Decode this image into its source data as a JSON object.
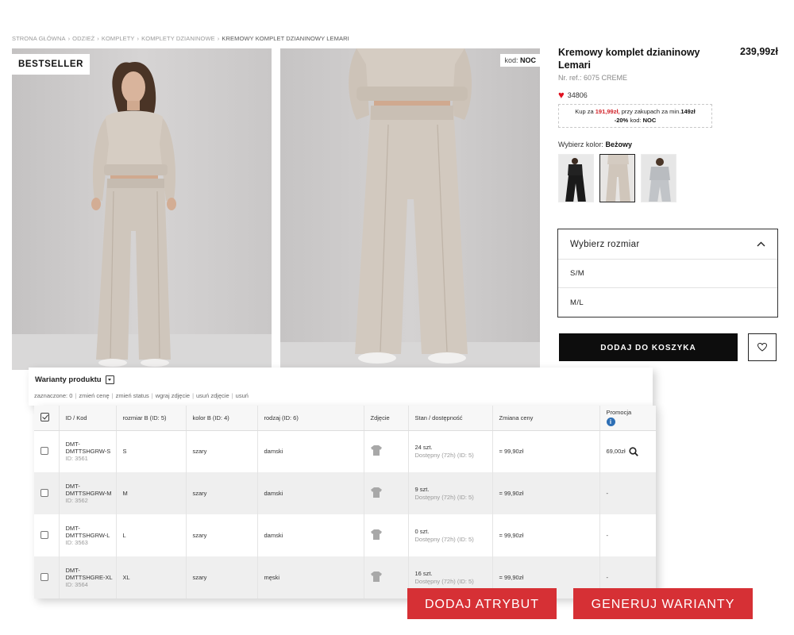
{
  "breadcrumb": [
    "STRONA GŁÓWNA",
    "ODZIEŻ",
    "KOMPLETY",
    "KOMPLETY DZIANINOWE",
    "KREMOWY KOMPLET DZIANINOWY LEMARI"
  ],
  "breadcrumb_separator": "›",
  "photos": {
    "badge": "BESTSELLER",
    "code_label": "kod:",
    "code_value": "NOC"
  },
  "product": {
    "title": "Kremowy komplet dzianinowy Lemari",
    "price": "239,99zł",
    "ref": "Nr. ref.: 6075 CREME",
    "likes": "34806",
    "promo": {
      "prefix": "Kup za",
      "price": "191,99zł,",
      "middle": "przy zakupach za min.",
      "min": "149zł",
      "discount": "-20%",
      "code_label": "kod:",
      "code": "NOC"
    },
    "color_label": "Wybierz kolor:",
    "color_value": "Beżowy",
    "swatches": [
      "black",
      "beige",
      "grey"
    ],
    "size": {
      "header": "Wybierz rozmiar",
      "options": [
        "S/M",
        "M/L"
      ]
    },
    "add_to_cart": "DODAJ DO KOSZYKA"
  },
  "admin": {
    "title": "Warianty produktu",
    "links": [
      "zaznaczone: 0",
      "zmień cenę",
      "zmień status",
      "wgraj zdjęcie",
      "usuń zdjęcie",
      "usuń"
    ],
    "columns": [
      "ID / Kod",
      "rozmiar B (ID: 5)",
      "kolor B (ID: 4)",
      "rodzaj (ID: 6)",
      "Zdjęcie",
      "Stan / dostępność",
      "Zmiana ceny",
      "Promocja"
    ],
    "rows": [
      {
        "code": "DMT-DMTTSHGRW-S",
        "id": "ID: 3561",
        "size": "S",
        "color": "szary",
        "kind": "damski",
        "stock": "24 szt.",
        "availability": "Dostępny (72h) (ID: 5)",
        "price_change": "= 99,90zł",
        "promo": "69,00zł"
      },
      {
        "code": "DMT-DMTTSHGRW-M",
        "id": "ID: 3562",
        "size": "M",
        "color": "szary",
        "kind": "damski",
        "stock": "9 szt.",
        "availability": "Dostępny (72h) (ID: 5)",
        "price_change": "= 99,90zł",
        "promo": "-"
      },
      {
        "code": "DMT-DMTTSHGRW-L",
        "id": "ID: 3563",
        "size": "L",
        "color": "szary",
        "kind": "damski",
        "stock": "0 szt.",
        "availability": "Dostępny (72h) (ID: 5)",
        "price_change": "= 99,90zł",
        "promo": "-"
      },
      {
        "code": "DMT-DMTTSHGRE-XL",
        "id": "ID: 3564",
        "size": "XL",
        "color": "szary",
        "kind": "męski",
        "stock": "16 szt.",
        "availability": "Dostępny (72h) (ID: 5)",
        "price_change": "= 99,90zł",
        "promo": "-"
      }
    ],
    "buttons": {
      "add_attribute": "DODAJ ATRYBUT",
      "generate_variants": "GENERUJ WARIANTY"
    }
  },
  "colors": {
    "accent_red": "#d63035",
    "heart": "#e0101e",
    "cart_button": "#0d0d0d",
    "info_blue": "#2e6fb5"
  }
}
